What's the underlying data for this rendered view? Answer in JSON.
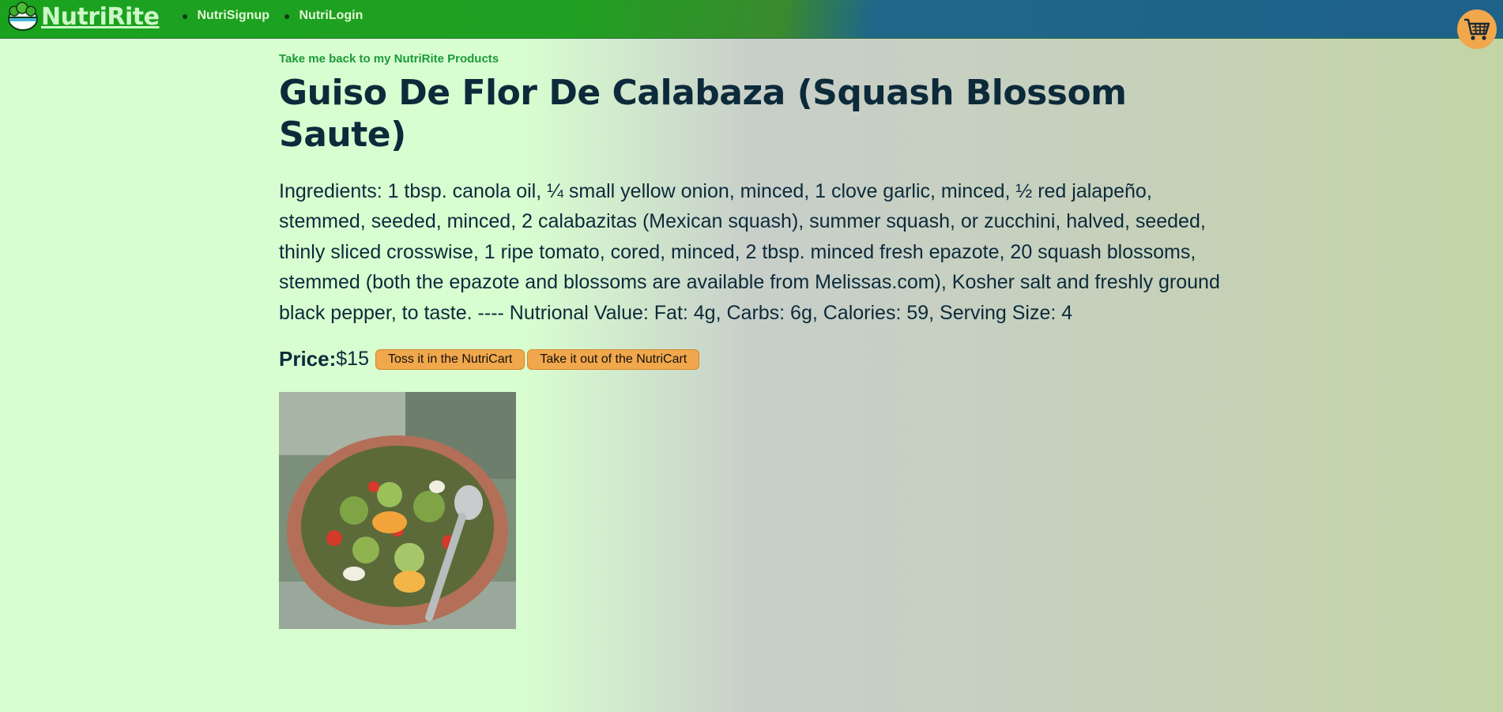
{
  "nav": {
    "brand": "NutriRite",
    "links": [
      "NutriSignup",
      "NutriLogin"
    ]
  },
  "product": {
    "back_link": "Take me back to my NutriRite Products",
    "title": "Guiso De Flor De Calabaza (Squash Blossom Saute)",
    "description": "Ingredients: 1 tbsp. canola oil, ¼ small yellow onion, minced, 1 clove garlic, minced, ½ red jalapeño, stemmed, seeded, minced, 2 calabazitas (Mexican squash), summer squash, or zucchini, halved, seeded, thinly sliced crosswise, 1 ripe tomato, cored, minced, 2 tbsp. minced fresh epazote, 20 squash blossoms, stemmed (both the epazote and blossoms are available from Melissas.com), Kosher salt and freshly ground black pepper, to taste. ---- Nutrional Value: Fat: 4g, Carbs: 6g, Calories: 59, Serving Size: 4",
    "price_label": "Price:",
    "price_value": "$15",
    "add_button": "Toss it in the NutriCart",
    "remove_button": "Take it out of the NutriCart"
  },
  "colors": {
    "nav_green": "#1aa21f",
    "nav_blue": "#1e6189",
    "accent_orange": "#f1a74b",
    "text_dark": "#0c2a3a",
    "link_green": "#1b9a3a"
  },
  "icons": {
    "brand": "salad-bowl-icon",
    "cart": "shopping-cart-icon"
  }
}
